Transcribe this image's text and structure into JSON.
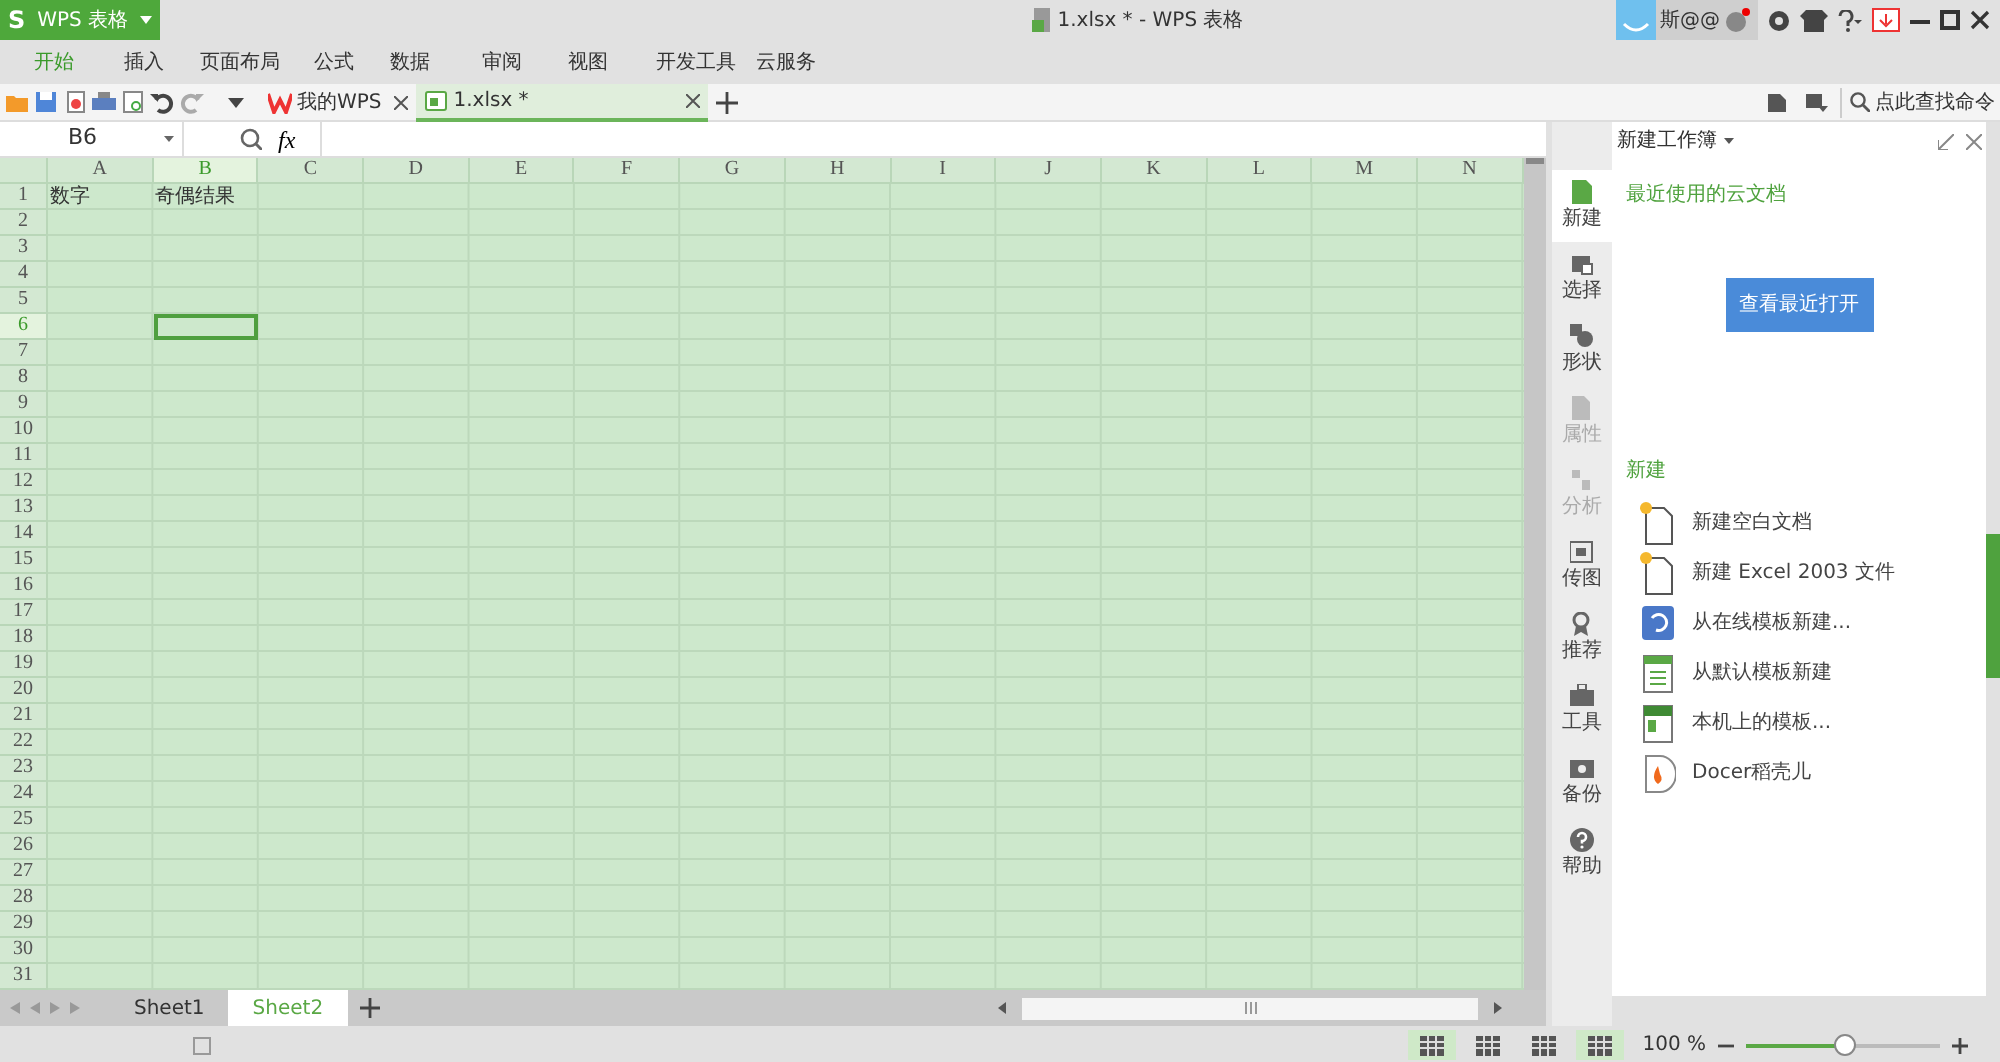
{
  "app_button": {
    "logo": "S",
    "label": "WPS 表格"
  },
  "window": {
    "title": "1.xlsx * - WPS 表格",
    "user": "斯@@"
  },
  "menu_tabs": [
    {
      "label": "开始",
      "selected": true
    },
    {
      "label": "插入",
      "selected": false
    },
    {
      "label": "页面布局",
      "selected": false
    },
    {
      "label": "公式",
      "selected": false
    },
    {
      "label": "数据",
      "selected": false
    },
    {
      "label": "审阅",
      "selected": false
    },
    {
      "label": "视图",
      "selected": false
    },
    {
      "label": "开发工具",
      "selected": false
    },
    {
      "label": "云服务",
      "selected": false
    }
  ],
  "doc_tabs": [
    {
      "label": "我的WPS",
      "selected": false
    },
    {
      "label": "1.xlsx *",
      "selected": true
    }
  ],
  "command_search": {
    "placeholder": "点此查找命令"
  },
  "formula_bar": {
    "name_box": "B6",
    "fx": "fx"
  },
  "columns": [
    {
      "label": "A",
      "selected": false
    },
    {
      "label": "B",
      "selected": true
    },
    {
      "label": "C",
      "selected": false
    },
    {
      "label": "D",
      "selected": false
    },
    {
      "label": "E",
      "selected": false
    },
    {
      "label": "F",
      "selected": false
    },
    {
      "label": "G",
      "selected": false
    },
    {
      "label": "H",
      "selected": false
    },
    {
      "label": "I",
      "selected": false
    },
    {
      "label": "J",
      "selected": false
    },
    {
      "label": "K",
      "selected": false
    },
    {
      "label": "L",
      "selected": false
    },
    {
      "label": "M",
      "selected": false
    },
    {
      "label": "N",
      "selected": false
    }
  ],
  "rows": [
    {
      "label": "1",
      "selected": false,
      "cells": [
        "数字",
        "奇偶结果"
      ]
    },
    {
      "label": "2",
      "selected": false
    },
    {
      "label": "3",
      "selected": false
    },
    {
      "label": "4",
      "selected": false
    },
    {
      "label": "5",
      "selected": false
    },
    {
      "label": "6",
      "selected": true
    },
    {
      "label": "7",
      "selected": false
    },
    {
      "label": "8",
      "selected": false
    },
    {
      "label": "9",
      "selected": false
    },
    {
      "label": "10",
      "selected": false
    },
    {
      "label": "11",
      "selected": false
    },
    {
      "label": "12",
      "selected": false
    },
    {
      "label": "13",
      "selected": false
    },
    {
      "label": "14",
      "selected": false
    },
    {
      "label": "15",
      "selected": false
    },
    {
      "label": "16",
      "selected": false
    },
    {
      "label": "17",
      "selected": false
    },
    {
      "label": "18",
      "selected": false
    },
    {
      "label": "19",
      "selected": false
    },
    {
      "label": "20",
      "selected": false
    },
    {
      "label": "21",
      "selected": false
    },
    {
      "label": "22",
      "selected": false
    },
    {
      "label": "23",
      "selected": false
    },
    {
      "label": "24",
      "selected": false
    },
    {
      "label": "25",
      "selected": false
    },
    {
      "label": "26",
      "selected": false
    },
    {
      "label": "27",
      "selected": false
    },
    {
      "label": "28",
      "selected": false
    },
    {
      "label": "29",
      "selected": false
    },
    {
      "label": "30",
      "selected": false
    },
    {
      "label": "31",
      "selected": false
    }
  ],
  "sheet_tabs": [
    {
      "label": "Sheet1",
      "selected": false
    },
    {
      "label": "Sheet2",
      "selected": true
    }
  ],
  "sidebar": {
    "items": [
      {
        "label": "新建",
        "selected": true,
        "disabled": false
      },
      {
        "label": "选择",
        "selected": false,
        "disabled": false
      },
      {
        "label": "形状",
        "selected": false,
        "disabled": false
      },
      {
        "label": "属性",
        "selected": false,
        "disabled": true
      },
      {
        "label": "分析",
        "selected": false,
        "disabled": true
      },
      {
        "label": "传图",
        "selected": false,
        "disabled": false
      },
      {
        "label": "推荐",
        "selected": false,
        "disabled": false
      },
      {
        "label": "工具",
        "selected": false,
        "disabled": false
      },
      {
        "label": "备份",
        "selected": false,
        "disabled": false
      },
      {
        "label": "帮助",
        "selected": false,
        "disabled": false
      }
    ]
  },
  "panel": {
    "title": "新建工作簿",
    "recent_heading": "最近使用的云文档",
    "recent_button": "查看最近打开",
    "new_heading": "新建",
    "items": [
      {
        "label": "新建空白文档",
        "kind": "blank"
      },
      {
        "label": "新建 Excel 2003 文件",
        "kind": "blank"
      },
      {
        "label": "从在线模板新建...",
        "kind": "online"
      },
      {
        "label": "从默认模板新建",
        "kind": "sheet"
      },
      {
        "label": "本机上的模板...",
        "kind": "local"
      },
      {
        "label": "Docer稻壳儿",
        "kind": "docer"
      }
    ]
  },
  "status_bar": {
    "zoom": "100 %",
    "zoom_slider": {
      "level": 0.5
    }
  }
}
